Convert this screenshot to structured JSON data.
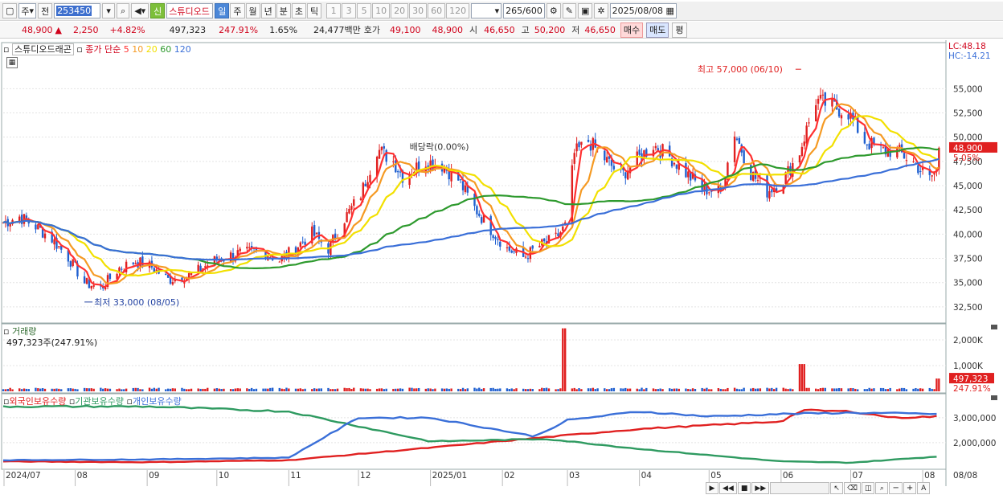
{
  "toolbar": {
    "market": "주",
    "kind": "전",
    "code": "253450",
    "name": "스튜디오드",
    "new_badge": "신",
    "periods": [
      "일",
      "주",
      "월",
      "년",
      "분",
      "초",
      "틱"
    ],
    "active_period": "일",
    "intervals": [
      "1",
      "3",
      "5",
      "10",
      "20",
      "30",
      "60",
      "120"
    ],
    "count": "265",
    "count_total": "/600",
    "date": "2025/08/08"
  },
  "quote": {
    "price": "48,900",
    "arrow": "▲",
    "change": "2,250",
    "change_pct": "+4.82%",
    "volume": "497,323",
    "vol_ratio": "247.91%",
    "turnover": "1.65%",
    "amount": "24,477백만",
    "ask_label": "호가",
    "ask": "49,100",
    "bid": "48,900",
    "open_label": "시",
    "open": "46,650",
    "high_label": "고",
    "high": "50,200",
    "low_label": "저",
    "low": "46,650",
    "buy": "매수",
    "sell": "매도",
    "eval": "평"
  },
  "legend": {
    "name": "스튜디오드래곤",
    "close": "종가 단순",
    "ma": [
      {
        "p": "5",
        "c": "#ff3030"
      },
      {
        "p": "10",
        "c": "#f59a23"
      },
      {
        "p": "20",
        "c": "#f2e000"
      },
      {
        "p": "60",
        "c": "#2e9a2e"
      },
      {
        "p": "120",
        "c": "#3a6fd8"
      }
    ]
  },
  "right_info": {
    "lc": "LC:48.18",
    "hc": "HC:-14.21"
  },
  "chart_data": [
    {
      "type": "candlestick",
      "title": "스튜디오드래곤",
      "ylim": [
        31000,
        59500
      ],
      "yticks": [
        "55,000",
        "52,500",
        "50,000",
        "47,500",
        "45,000",
        "42,500",
        "40,000",
        "37,500",
        "35,000",
        "32,500"
      ],
      "current": {
        "value": "48,900",
        "pct": "5.05%"
      },
      "annotations": [
        {
          "text": "최고 57,000 (06/10)",
          "value": 57000
        },
        {
          "text": "최저 33,000 (08/05)",
          "value": 33000
        },
        {
          "text": "배당락(0.00%)"
        }
      ],
      "anchors": [
        [
          "2024-07-01",
          41200
        ],
        [
          "2024-07-08",
          41800
        ],
        [
          "2024-07-15",
          40800
        ],
        [
          "2024-07-22",
          39500
        ],
        [
          "2024-07-29",
          37600
        ],
        [
          "2024-08-05",
          35000
        ],
        [
          "2024-08-12",
          34400
        ],
        [
          "2024-08-20",
          36500
        ],
        [
          "2024-08-27",
          37200
        ],
        [
          "2024-09-03",
          36600
        ],
        [
          "2024-09-10",
          35300
        ],
        [
          "2024-09-20",
          35800
        ],
        [
          "2024-09-30",
          37300
        ],
        [
          "2024-10-10",
          38000
        ],
        [
          "2024-10-21",
          38200
        ],
        [
          "2024-10-28",
          37300
        ],
        [
          "2024-11-04",
          38600
        ],
        [
          "2024-11-11",
          40100
        ],
        [
          "2024-11-18",
          38500
        ],
        [
          "2024-11-25",
          41600
        ],
        [
          "2024-12-02",
          44100
        ],
        [
          "2024-12-09",
          48800
        ],
        [
          "2024-12-16",
          47500
        ],
        [
          "2024-12-20",
          46000
        ],
        [
          "2024-12-30",
          47500
        ],
        [
          "2025-01-06",
          47100
        ],
        [
          "2025-01-13",
          45600
        ],
        [
          "2025-01-20",
          42700
        ],
        [
          "2025-01-27",
          40500
        ],
        [
          "2025-02-03",
          38500
        ],
        [
          "2025-02-10",
          37600
        ],
        [
          "2025-02-17",
          38800
        ],
        [
          "2025-02-24",
          39600
        ],
        [
          "2025-02-28",
          40800
        ],
        [
          "2025-03-04",
          48300
        ],
        [
          "2025-03-10",
          49600
        ],
        [
          "2025-03-17",
          47800
        ],
        [
          "2025-03-24",
          46000
        ],
        [
          "2025-03-31",
          47700
        ],
        [
          "2025-04-07",
          49200
        ],
        [
          "2025-04-14",
          48000
        ],
        [
          "2025-04-21",
          46300
        ],
        [
          "2025-04-28",
          44700
        ],
        [
          "2025-05-06",
          44300
        ],
        [
          "2025-05-12",
          50500
        ],
        [
          "2025-05-19",
          46300
        ],
        [
          "2025-05-26",
          44400
        ],
        [
          "2025-06-02",
          45600
        ],
        [
          "2025-06-09",
          48500
        ],
        [
          "2025-06-16",
          53800
        ],
        [
          "2025-06-23",
          53200
        ],
        [
          "2025-06-30",
          52500
        ],
        [
          "2025-07-07",
          49600
        ],
        [
          "2025-07-14",
          48600
        ],
        [
          "2025-07-21",
          48600
        ],
        [
          "2025-07-28",
          47400
        ],
        [
          "2025-08-04",
          45700
        ],
        [
          "2025-08-07",
          46650
        ],
        [
          "2025-08-08",
          48900
        ]
      ]
    },
    {
      "type": "bar",
      "title": "거래량",
      "label": "497,323주(247.91%)",
      "ylim": [
        0,
        2500000
      ],
      "yticks": [
        "2,000K",
        "1,000K"
      ],
      "current": {
        "value": "497,323",
        "pct": "247.91%"
      },
      "spikes": [
        [
          "2025-02-28",
          2450000
        ],
        [
          "2025-06-10",
          1060000
        ],
        [
          "2025-08-08",
          497323
        ]
      ]
    },
    {
      "type": "line",
      "series_labels": [
        "외국인보유수량",
        "기관보유수량",
        "개인보유수량"
      ],
      "ylim": [
        1000000,
        3800000
      ],
      "yticks": [
        "3,000,000",
        "2,000,000"
      ],
      "series": [
        {
          "name": "외국인보유수량",
          "color": "#e02020",
          "points": [
            [
              "2024-07-01",
              1250000
            ],
            [
              "2024-09-01",
              1220000
            ],
            [
              "2024-11-01",
              1300000
            ],
            [
              "2025-01-01",
              1800000
            ],
            [
              "2025-03-01",
              2300000
            ],
            [
              "2025-04-01",
              2550000
            ],
            [
              "2025-05-01",
              2700000
            ],
            [
              "2025-06-01",
              2850000
            ],
            [
              "2025-06-10",
              3300000
            ],
            [
              "2025-07-01",
              3250000
            ],
            [
              "2025-07-20",
              3000000
            ],
            [
              "2025-08-08",
              3050000
            ]
          ]
        },
        {
          "name": "기관보유수량",
          "color": "#2e9a60",
          "points": [
            [
              "2024-07-01",
              3450000
            ],
            [
              "2024-09-01",
              3450000
            ],
            [
              "2024-11-01",
              3250000
            ],
            [
              "2025-01-01",
              2050000
            ],
            [
              "2025-02-20",
              2150000
            ],
            [
              "2025-04-01",
              1750000
            ],
            [
              "2025-05-01",
              1500000
            ],
            [
              "2025-06-01",
              1250000
            ],
            [
              "2025-07-01",
              1200000
            ],
            [
              "2025-08-08",
              1450000
            ]
          ]
        },
        {
          "name": "개인보유수량",
          "color": "#3a6fd8",
          "points": [
            [
              "2024-07-01",
              1300000
            ],
            [
              "2024-09-01",
              1330000
            ],
            [
              "2024-11-01",
              1400000
            ],
            [
              "2024-12-01",
              3000000
            ],
            [
              "2025-01-01",
              3000000
            ],
            [
              "2025-02-15",
              2250000
            ],
            [
              "2025-03-01",
              2900000
            ],
            [
              "2025-04-01",
              3250000
            ],
            [
              "2025-05-01",
              3050000
            ],
            [
              "2025-06-01",
              3150000
            ],
            [
              "2025-07-01",
              3200000
            ],
            [
              "2025-08-08",
              3150000
            ]
          ]
        }
      ]
    }
  ],
  "xaxis": {
    "labels": [
      "2024/07",
      "08",
      "09",
      "10",
      "11",
      "12",
      "2025/01",
      "02",
      "03",
      "04",
      "05",
      "06",
      "07",
      "08"
    ],
    "right_label": "08/08"
  }
}
